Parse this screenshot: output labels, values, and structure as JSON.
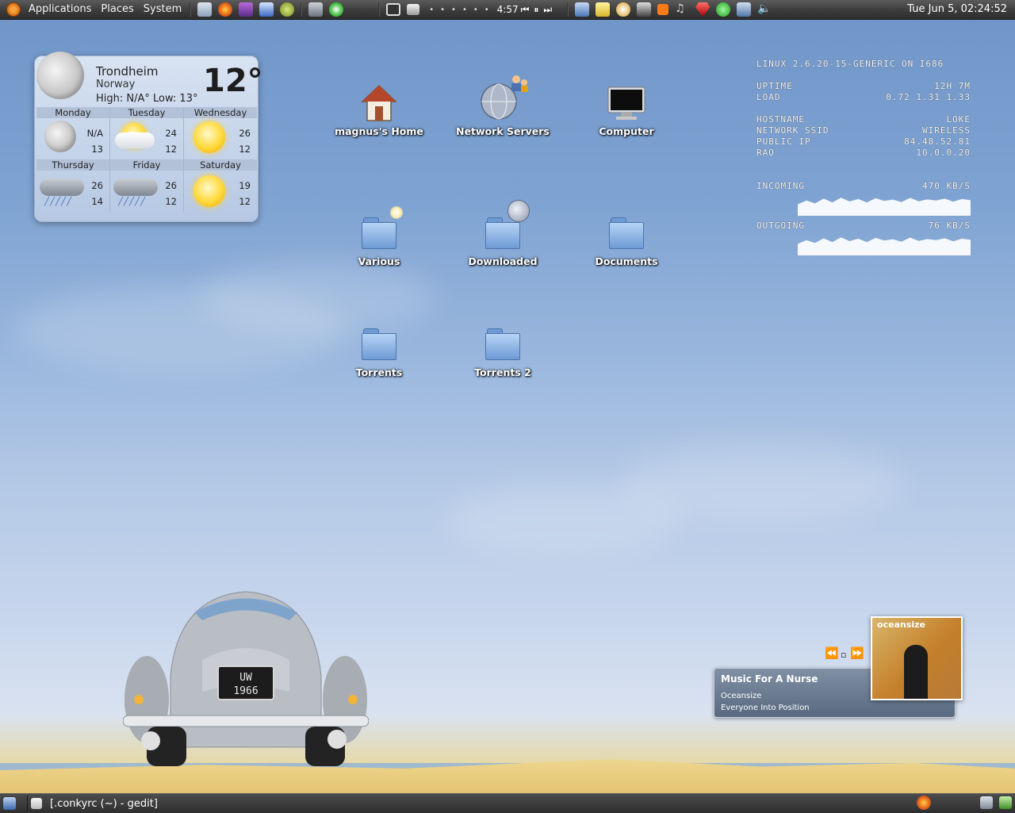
{
  "top_panel": {
    "menus": [
      "Applications",
      "Places",
      "System"
    ],
    "media_time": "4:57",
    "clock": "Tue Jun  5, 02:24:52"
  },
  "weather": {
    "city": "Trondheim",
    "country": "Norway",
    "high_low": "High: N/A°   Low: 13°",
    "temp": "12°",
    "days": [
      {
        "name": "Monday",
        "hi": "N/A",
        "lo": "13",
        "icon": "moon-icon"
      },
      {
        "name": "Tuesday",
        "hi": "24",
        "lo": "12",
        "icon": "partly-cloudy-icon"
      },
      {
        "name": "Wednesday",
        "hi": "26",
        "lo": "12",
        "icon": "sun-icon"
      },
      {
        "name": "Thursday",
        "hi": "26",
        "lo": "14",
        "icon": "rain-icon"
      },
      {
        "name": "Friday",
        "hi": "26",
        "lo": "12",
        "icon": "rain-icon"
      },
      {
        "name": "Saturday",
        "hi": "19",
        "lo": "12",
        "icon": "sun-icon"
      }
    ]
  },
  "desktop_icons": [
    {
      "label": "magnus's Home",
      "icon": "home-icon"
    },
    {
      "label": "Network Servers",
      "icon": "network-icon"
    },
    {
      "label": "Computer",
      "icon": "computer-icon"
    },
    {
      "label": "Various",
      "icon": "folder-icon"
    },
    {
      "label": "Downloaded",
      "icon": "folder-icon"
    },
    {
      "label": "Documents",
      "icon": "folder-icon"
    },
    {
      "label": "Torrents",
      "icon": "folder-icon"
    },
    {
      "label": "Torrents 2",
      "icon": "folder-icon"
    }
  ],
  "conky": {
    "header": "Linux 2.6.20-15-generic on i686",
    "uptime_label": "Uptime",
    "uptime": "12h 7m",
    "load_label": "Load",
    "load": "0.72 1.31 1.33",
    "hostname_label": "Hostname",
    "hostname": "loke",
    "ssid_label": "Network SSID",
    "ssid": "wireless",
    "public_ip_label": "Public IP",
    "public_ip": "84.48.52.81",
    "rao_label": "RAO",
    "rao": "10.0.0.20",
    "incoming_label": "Incoming",
    "incoming": "470 KB/S",
    "outgoing_label": "Outgoing",
    "outgoing": "76 KB/S"
  },
  "music": {
    "title": "Music For A Nurse",
    "artist": "Oceansize",
    "album": "Everyone Into Position",
    "cover_text": "oceansize"
  },
  "car": {
    "plate_line1": "UW",
    "plate_line2": "1966"
  },
  "bottom_panel": {
    "task": "[.conkyrc (~) - gedit]"
  }
}
